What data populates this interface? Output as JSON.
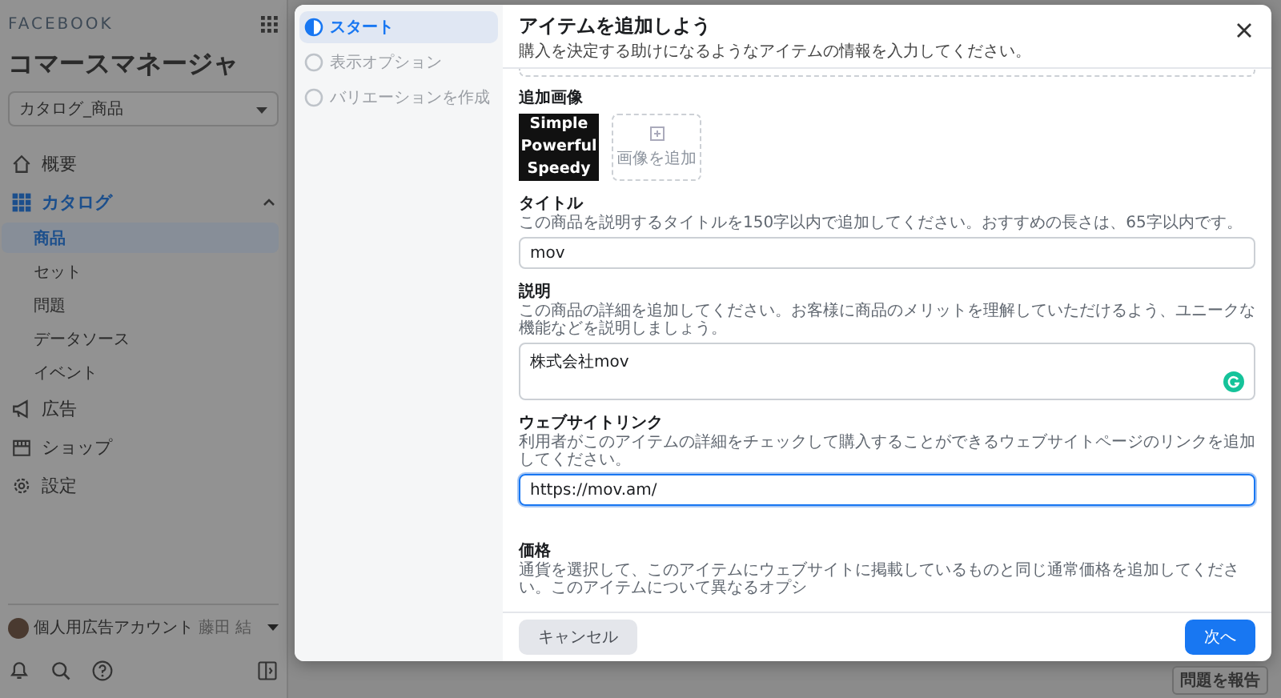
{
  "sidebar": {
    "brand": "FACEBOOK",
    "title": "コマースマネージャ",
    "catalog_select": {
      "value": "カタログ_商品"
    },
    "nav": [
      {
        "kind": "home",
        "label": "概要",
        "selected": false
      },
      {
        "kind": "catalog",
        "label": "カタログ",
        "selected": true,
        "expanded": true,
        "children": [
          {
            "label": "商品",
            "selected": true
          },
          {
            "label": "セット",
            "selected": false
          },
          {
            "label": "問題",
            "selected": false
          },
          {
            "label": "データソース",
            "selected": false
          },
          {
            "label": "イベント",
            "selected": false
          }
        ]
      },
      {
        "kind": "ads",
        "label": "広告",
        "selected": false
      },
      {
        "kind": "shop",
        "label": "ショップ",
        "selected": false
      },
      {
        "kind": "settings",
        "label": "設定",
        "selected": false
      }
    ],
    "account": {
      "name": "個人用広告アカウント",
      "user": "藤田 結"
    }
  },
  "modal": {
    "steps": [
      {
        "label": "スタート",
        "selected": true
      },
      {
        "label": "表示オプション",
        "selected": false
      },
      {
        "label": "バリエーションを作成",
        "selected": false
      }
    ],
    "title": "アイテムを追加しよう",
    "subtitle": "購入を決定する助けになるようなアイテムの情報を入力してください。",
    "additional_images": {
      "label": "追加画像",
      "image_lines": [
        "Simple",
        "Powerful",
        "Speedy"
      ],
      "add_label": "画像を追加"
    },
    "fields": [
      {
        "kind": "input",
        "label": "タイトル",
        "hint": "この商品を説明するタイトルを150字以内で追加してください。おすすめの長さは、65字以内です。",
        "value": "mov",
        "focused": false
      },
      {
        "kind": "textarea",
        "label": "説明",
        "hint": "この商品の詳細を追加してください。お客様に商品のメリットを理解していただけるよう、ユニークな機能などを説明しましょう。",
        "value": "株式会社mov",
        "focused": false
      },
      {
        "kind": "input",
        "label": "ウェブサイトリンク",
        "hint": "利用者がこのアイテムの詳細をチェックして購入することができるウェブサイトページのリンクを追加してください。",
        "value": "https://mov.am/",
        "focused": true
      },
      {
        "kind": "text",
        "label": "価格",
        "hint": "通貨を選択して、このアイテムにウェブサイトに掲載しているものと同じ通常価格を追加してください。このアイテムについて異なるオプシ"
      }
    ],
    "cancel": "キャンセル",
    "next": "次へ"
  },
  "report_button": "問題を報告"
}
